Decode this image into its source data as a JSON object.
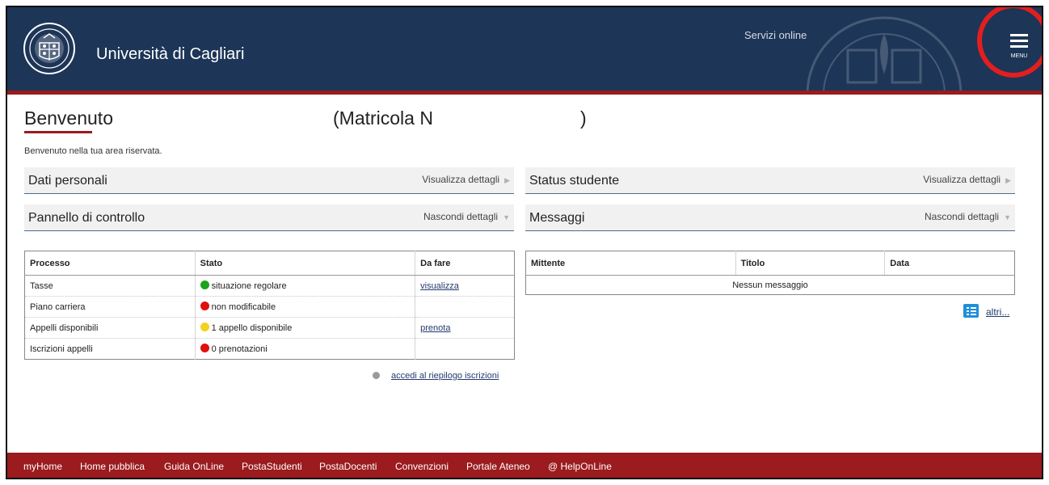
{
  "header": {
    "university_name": "Università di Cagliari",
    "services_label": "Servizi online",
    "menu_label": "MENU",
    "bg_color": "#1d3557",
    "accent_color": "#9b1b1e"
  },
  "welcome": {
    "title": "Benvenuto",
    "matricola_prefix": "(Matricola N",
    "matricola_suffix": ")",
    "subtitle": "Benvenuto nella tua area riservata."
  },
  "panels": {
    "dati_personali": {
      "title": "Dati personali",
      "action": "Visualizza dettagli"
    },
    "status_studente": {
      "title": "Status studente",
      "action": "Visualizza dettagli"
    },
    "pannello_controllo": {
      "title": "Pannello di controllo",
      "action": "Nascondi dettagli"
    },
    "messaggi": {
      "title": "Messaggi",
      "action": "Nascondi dettagli"
    }
  },
  "control_table": {
    "headers": [
      "Processo",
      "Stato",
      "Da fare"
    ],
    "rows": [
      {
        "processo": "Tasse",
        "stato": "situazione regolare",
        "status_color": "#1aa51a",
        "da_fare": "visualizza"
      },
      {
        "processo": "Piano carriera",
        "stato": "non modificabile",
        "status_color": "#e01010",
        "da_fare": ""
      },
      {
        "processo": "Appelli disponibili",
        "stato": "1 appello disponibile",
        "status_color": "#f2d21c",
        "da_fare": "prenota"
      },
      {
        "processo": "Iscrizioni appelli",
        "stato": "0 prenotazioni",
        "status_color": "#e01010",
        "da_fare": ""
      }
    ],
    "riepilogo_link": "accedi al riepilogo iscrizioni"
  },
  "messages_table": {
    "headers": [
      "Mittente",
      "Titolo",
      "Data"
    ],
    "empty_text": "Nessun messaggio",
    "more_link": "altri..."
  },
  "footer": {
    "links": [
      "myHome",
      "Home pubblica",
      "Guida OnLine",
      "PostaStudenti",
      "PostaDocenti",
      "Convenzioni",
      "Portale Ateneo",
      "@ HelpOnLine"
    ]
  }
}
